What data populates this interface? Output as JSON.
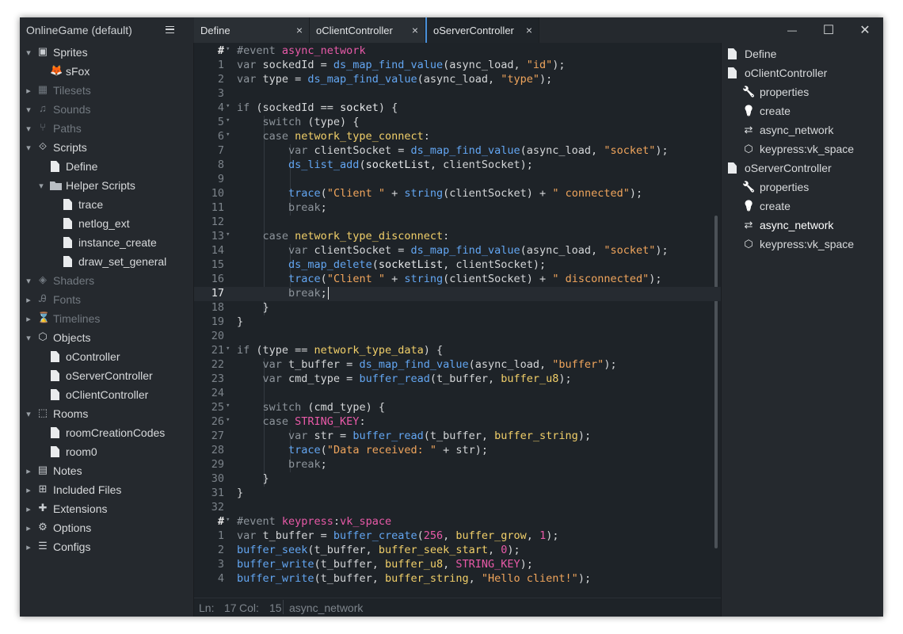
{
  "project": {
    "title": "OnlineGame (default)"
  },
  "tabs": [
    {
      "label": "Define",
      "close": "×"
    },
    {
      "label": "oClientController",
      "close": "×"
    },
    {
      "label": "oServerController",
      "close": "×"
    }
  ],
  "window_controls": {
    "minimize": "—",
    "maximize": "☐",
    "close": "✕"
  },
  "tree": [
    {
      "label": "Sprites",
      "chevron": "⌄",
      "icon": "image-icon"
    },
    {
      "label": "sFox",
      "icon": "fox-sprite-icon"
    },
    {
      "label": "Tilesets",
      "chevron": "›",
      "icon": "grid-icon"
    },
    {
      "label": "Sounds",
      "chevron": "⌄",
      "icon": "music-icon"
    },
    {
      "label": "Paths",
      "chevron": "⌄",
      "icon": "path-icon"
    },
    {
      "label": "Scripts",
      "chevron": "⌄",
      "icon": "script-icon"
    },
    {
      "label": "Define",
      "icon": "file-icon"
    },
    {
      "label": "Helper Scripts",
      "chevron": "⌄",
      "icon": "folder-icon"
    },
    {
      "label": "trace",
      "icon": "file-icon"
    },
    {
      "label": "netlog_ext",
      "icon": "file-icon"
    },
    {
      "label": "instance_create",
      "icon": "file-icon"
    },
    {
      "label": "draw_set_general",
      "icon": "file-icon"
    },
    {
      "label": "Shaders",
      "chevron": "⌄",
      "icon": "layers-icon"
    },
    {
      "label": "Fonts",
      "chevron": "›",
      "icon": "font-icon"
    },
    {
      "label": "Timelines",
      "chevron": "›",
      "icon": "hourglass-icon"
    },
    {
      "label": "Objects",
      "chevron": "⌄",
      "icon": "cube-icon"
    },
    {
      "label": "oController",
      "icon": "file-icon"
    },
    {
      "label": "oServerController",
      "icon": "file-icon"
    },
    {
      "label": "oClientController",
      "icon": "file-icon"
    },
    {
      "label": "Rooms",
      "chevron": "⌄",
      "icon": "room-icon"
    },
    {
      "label": "roomCreationCodes",
      "icon": "file-icon"
    },
    {
      "label": "room0",
      "icon": "file-icon"
    },
    {
      "label": "Notes",
      "chevron": "›",
      "icon": "notes-icon"
    },
    {
      "label": "Included Files",
      "chevron": "›",
      "icon": "plus-box-icon"
    },
    {
      "label": "Extensions",
      "chevron": "›",
      "icon": "puzzle-icon"
    },
    {
      "label": "Options",
      "chevron": "›",
      "icon": "gear-icon"
    },
    {
      "label": "Configs",
      "chevron": "›",
      "icon": "sliders-icon"
    }
  ],
  "editor": {
    "lines": [
      {
        "num": "#",
        "fold": "⌄",
        "tokens": [
          [
            "cmt",
            "#event "
          ],
          [
            "ev",
            "async_network"
          ]
        ]
      },
      {
        "num": "1",
        "tokens": [
          [
            "var",
            "var "
          ],
          [
            "id",
            "sockedId = "
          ],
          [
            "fn",
            "ds_map_find_value"
          ],
          [
            "id",
            "(async_load, "
          ],
          [
            "str",
            "\"id\""
          ],
          [
            "id",
            ");"
          ]
        ]
      },
      {
        "num": "2",
        "tokens": [
          [
            "var",
            "var "
          ],
          [
            "id",
            "type = "
          ],
          [
            "fn",
            "ds_map_find_value"
          ],
          [
            "id",
            "(async_load, "
          ],
          [
            "str",
            "\"type\""
          ],
          [
            "id",
            ");"
          ]
        ]
      },
      {
        "num": "3",
        "tokens": []
      },
      {
        "num": "4",
        "fold": "⌄",
        "tokens": [
          [
            "ctl",
            "if "
          ],
          [
            "id",
            "(sockedId == "
          ],
          [
            "ident",
            "socket"
          ],
          [
            "id",
            ") {"
          ]
        ]
      },
      {
        "num": "5",
        "fold": "⌄",
        "tokens": [
          [
            "id",
            "    "
          ],
          [
            "ctl",
            "switch "
          ],
          [
            "id",
            "(type) {"
          ]
        ]
      },
      {
        "num": "6",
        "fold": "⌄",
        "tokens": [
          [
            "id",
            "    "
          ],
          [
            "ctl",
            "case "
          ],
          [
            "const",
            "network_type_connect"
          ],
          [
            "id",
            ":"
          ]
        ]
      },
      {
        "num": "7",
        "tokens": [
          [
            "id",
            "        "
          ],
          [
            "var",
            "var "
          ],
          [
            "id",
            "clientSocket = "
          ],
          [
            "fn",
            "ds_map_find_value"
          ],
          [
            "id",
            "(async_load, "
          ],
          [
            "str",
            "\"socket\""
          ],
          [
            "id",
            ");"
          ]
        ]
      },
      {
        "num": "8",
        "tokens": [
          [
            "id",
            "        "
          ],
          [
            "fn",
            "ds_list_add"
          ],
          [
            "id",
            "("
          ],
          [
            "ident",
            "socketList"
          ],
          [
            "id",
            ", clientSocket);"
          ]
        ]
      },
      {
        "num": "9",
        "tokens": []
      },
      {
        "num": "10",
        "tokens": [
          [
            "id",
            "        "
          ],
          [
            "fn",
            "trace"
          ],
          [
            "id",
            "("
          ],
          [
            "str",
            "\"Client \""
          ],
          [
            "id",
            " + "
          ],
          [
            "fn",
            "string"
          ],
          [
            "id",
            "(clientSocket) + "
          ],
          [
            "str",
            "\" connected\""
          ],
          [
            "id",
            ");"
          ]
        ]
      },
      {
        "num": "11",
        "tokens": [
          [
            "id",
            "        "
          ],
          [
            "ctl",
            "break"
          ],
          [
            "id",
            ";"
          ]
        ]
      },
      {
        "num": "12",
        "tokens": []
      },
      {
        "num": "13",
        "fold": "⌄",
        "tokens": [
          [
            "id",
            "    "
          ],
          [
            "ctl",
            "case "
          ],
          [
            "const",
            "network_type_disconnect"
          ],
          [
            "id",
            ":"
          ]
        ]
      },
      {
        "num": "14",
        "tokens": [
          [
            "id",
            "        "
          ],
          [
            "var",
            "var "
          ],
          [
            "id",
            "clientSocket = "
          ],
          [
            "fn",
            "ds_map_find_value"
          ],
          [
            "id",
            "(async_load, "
          ],
          [
            "str",
            "\"socket\""
          ],
          [
            "id",
            ");"
          ]
        ]
      },
      {
        "num": "15",
        "tokens": [
          [
            "id",
            "        "
          ],
          [
            "fn",
            "ds_map_delete"
          ],
          [
            "id",
            "("
          ],
          [
            "ident",
            "socketList"
          ],
          [
            "id",
            ", clientSocket);"
          ]
        ]
      },
      {
        "num": "16",
        "tokens": [
          [
            "id",
            "        "
          ],
          [
            "fn",
            "trace"
          ],
          [
            "id",
            "("
          ],
          [
            "str",
            "\"Client \""
          ],
          [
            "id",
            " + "
          ],
          [
            "fn",
            "string"
          ],
          [
            "id",
            "(clientSocket) + "
          ],
          [
            "str",
            "\" disconnected\""
          ],
          [
            "id",
            ");"
          ]
        ]
      },
      {
        "num": "17",
        "current": true,
        "tokens": [
          [
            "id",
            "        "
          ],
          [
            "ctl",
            "break"
          ],
          [
            "id",
            ";"
          ]
        ]
      },
      {
        "num": "18",
        "tokens": [
          [
            "id",
            "    }"
          ]
        ]
      },
      {
        "num": "19",
        "tokens": [
          [
            "id",
            "}"
          ]
        ]
      },
      {
        "num": "20",
        "tokens": []
      },
      {
        "num": "21",
        "fold": "⌄",
        "tokens": [
          [
            "ctl",
            "if "
          ],
          [
            "id",
            "(type == "
          ],
          [
            "const",
            "network_type_data"
          ],
          [
            "id",
            ") {"
          ]
        ]
      },
      {
        "num": "22",
        "tokens": [
          [
            "id",
            "    "
          ],
          [
            "var",
            "var "
          ],
          [
            "id",
            "t_buffer = "
          ],
          [
            "fn",
            "ds_map_find_value"
          ],
          [
            "id",
            "(async_load, "
          ],
          [
            "str",
            "\"buffer\""
          ],
          [
            "id",
            ");"
          ]
        ]
      },
      {
        "num": "23",
        "tokens": [
          [
            "id",
            "    "
          ],
          [
            "var",
            "var "
          ],
          [
            "id",
            "cmd_type = "
          ],
          [
            "fn",
            "buffer_read"
          ],
          [
            "id",
            "(t_buffer, "
          ],
          [
            "const",
            "buffer_u8"
          ],
          [
            "id",
            ");"
          ]
        ]
      },
      {
        "num": "24",
        "tokens": []
      },
      {
        "num": "25",
        "fold": "⌄",
        "tokens": [
          [
            "id",
            "    "
          ],
          [
            "ctl",
            "switch "
          ],
          [
            "id",
            "(cmd_type) {"
          ]
        ]
      },
      {
        "num": "26",
        "fold": "⌄",
        "tokens": [
          [
            "id",
            "    "
          ],
          [
            "ctl",
            "case "
          ],
          [
            "ev",
            "STRING_KEY"
          ],
          [
            "id",
            ":"
          ]
        ]
      },
      {
        "num": "27",
        "tokens": [
          [
            "id",
            "        "
          ],
          [
            "var",
            "var "
          ],
          [
            "id",
            "str = "
          ],
          [
            "fn",
            "buffer_read"
          ],
          [
            "id",
            "(t_buffer, "
          ],
          [
            "const",
            "buffer_string"
          ],
          [
            "id",
            ");"
          ]
        ]
      },
      {
        "num": "28",
        "tokens": [
          [
            "id",
            "        "
          ],
          [
            "fn",
            "trace"
          ],
          [
            "id",
            "("
          ],
          [
            "str",
            "\"Data received: \""
          ],
          [
            "id",
            " + str);"
          ]
        ]
      },
      {
        "num": "29",
        "tokens": [
          [
            "id",
            "        "
          ],
          [
            "ctl",
            "break"
          ],
          [
            "id",
            ";"
          ]
        ]
      },
      {
        "num": "30",
        "tokens": [
          [
            "id",
            "    }"
          ]
        ]
      },
      {
        "num": "31",
        "tokens": [
          [
            "id",
            "}"
          ]
        ]
      },
      {
        "num": "32",
        "tokens": []
      },
      {
        "num": "#",
        "fold": "⌄",
        "tokens": [
          [
            "cmt",
            "#event "
          ],
          [
            "ev",
            "keypress"
          ],
          [
            "id",
            ":"
          ],
          [
            "ev",
            "vk_space"
          ]
        ]
      },
      {
        "num": "1",
        "tokens": [
          [
            "var",
            "var "
          ],
          [
            "id",
            "t_buffer = "
          ],
          [
            "fn",
            "buffer_create"
          ],
          [
            "id",
            "("
          ],
          [
            "num",
            "256"
          ],
          [
            "id",
            ", "
          ],
          [
            "const",
            "buffer_grow"
          ],
          [
            "id",
            ", "
          ],
          [
            "num",
            "1"
          ],
          [
            "id",
            ");"
          ]
        ]
      },
      {
        "num": "2",
        "tokens": [
          [
            "fn",
            "buffer_seek"
          ],
          [
            "id",
            "(t_buffer, "
          ],
          [
            "const",
            "buffer_seek_start"
          ],
          [
            "id",
            ", "
          ],
          [
            "num",
            "0"
          ],
          [
            "id",
            ");"
          ]
        ]
      },
      {
        "num": "3",
        "tokens": [
          [
            "fn",
            "buffer_write"
          ],
          [
            "id",
            "(t_buffer, "
          ],
          [
            "const",
            "buffer_u8"
          ],
          [
            "id",
            ", "
          ],
          [
            "ev",
            "STRING_KEY"
          ],
          [
            "id",
            ");"
          ]
        ]
      },
      {
        "num": "4",
        "tokens": [
          [
            "fn",
            "buffer_write"
          ],
          [
            "id",
            "(t_buffer, "
          ],
          [
            "const",
            "buffer_string"
          ],
          [
            "id",
            ", "
          ],
          [
            "str",
            "\"Hello client!\""
          ],
          [
            "id",
            ");"
          ]
        ]
      }
    ]
  },
  "status": {
    "ln_label": "Ln:",
    "ln": "17",
    "col_label": "Col:",
    "col": "15",
    "context": "async_network"
  },
  "outline": [
    {
      "label": "Define",
      "icon": "file-icon",
      "level": 0
    },
    {
      "label": "oClientController",
      "icon": "file-icon",
      "level": 0
    },
    {
      "label": "properties",
      "icon": "wrench-icon",
      "level": 1
    },
    {
      "label": "create",
      "icon": "lightbulb-icon",
      "level": 1
    },
    {
      "label": "async_network",
      "icon": "arrows-icon",
      "level": 1
    },
    {
      "label": "keypress:vk_space",
      "icon": "hexagon-icon",
      "level": 1
    },
    {
      "label": "oServerController",
      "icon": "file-icon",
      "level": 0
    },
    {
      "label": "properties",
      "icon": "wrench-icon",
      "level": 1
    },
    {
      "label": "create",
      "icon": "lightbulb-icon",
      "level": 1
    },
    {
      "label": "async_network",
      "icon": "arrows-icon",
      "level": 1,
      "selected": true
    },
    {
      "label": "keypress:vk_space",
      "icon": "hexagon-icon",
      "level": 1
    }
  ]
}
